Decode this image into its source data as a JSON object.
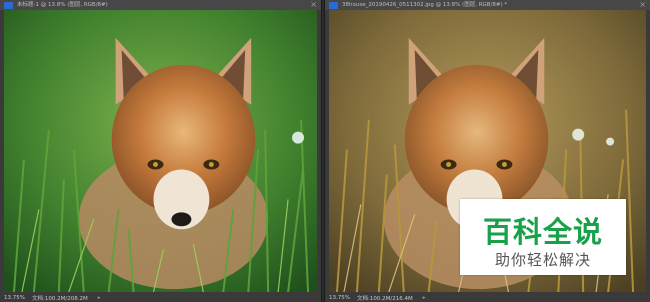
{
  "left_doc": {
    "title": "未标题-1 @ 13.8% (图层, RGB/8#)",
    "zoom": "13.75%",
    "doc_info": "文档:100.2M/208.2M"
  },
  "right_doc": {
    "title": "38house_20190426_0511302.jpg @ 13.8% (图层, RGB/8#) *",
    "zoom": "13.75%",
    "doc_info": "文档:100.2M/216.4M"
  },
  "watermark": {
    "title": "百科全说",
    "subtitle": "助你轻松解决"
  },
  "icons": {
    "close": "×",
    "arrow": "▸"
  },
  "colors": {
    "watermark_green": "#19a14a"
  }
}
